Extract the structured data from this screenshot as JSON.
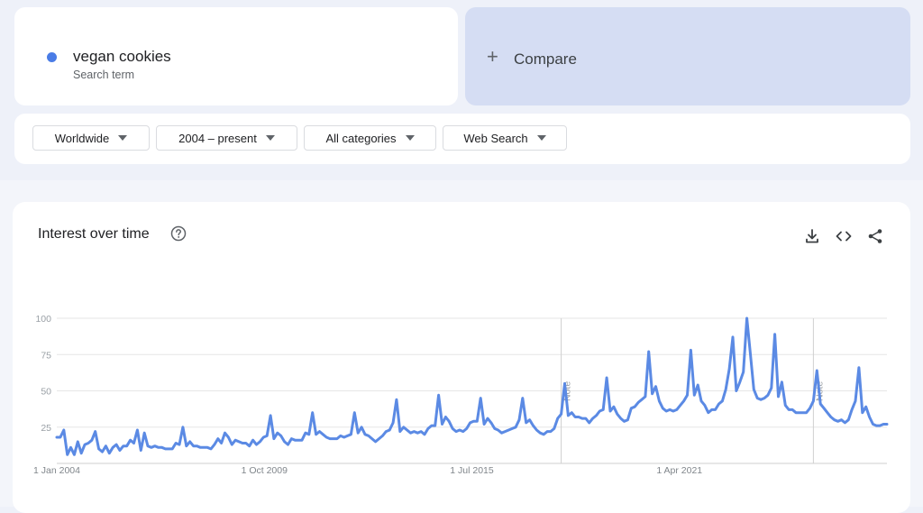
{
  "search_term": {
    "name": "vegan cookies",
    "subtitle": "Search term",
    "color": "#4a7ce6"
  },
  "compare": {
    "label": "Compare"
  },
  "filters": {
    "region": "Worldwide",
    "time": "2004 – present",
    "category": "All categories",
    "property": "Web Search"
  },
  "chart_panel": {
    "title": "Interest over time"
  },
  "icons": [
    "help-icon",
    "download-icon",
    "embed-icon",
    "share-icon"
  ],
  "chart_data": {
    "type": "line",
    "title": "Interest over time",
    "xlabel": "",
    "ylabel": "",
    "ylim": [
      0,
      100
    ],
    "yticks": [
      25,
      50,
      75,
      100
    ],
    "xtick_labels": [
      "1 Jan 2004",
      "1 Oct 2009",
      "1 Jul 2015",
      "1 Apr 2021"
    ],
    "notes": [
      {
        "label": "Note",
        "date": "2016-01"
      },
      {
        "label": "Note",
        "date": "2022-01"
      }
    ],
    "grid": true,
    "legend": "none",
    "series": [
      {
        "name": "vegan cookies",
        "color": "#5b8ae4",
        "x_start": "2004-01",
        "x_step": "month",
        "values": [
          18,
          18,
          23,
          6,
          11,
          6,
          15,
          7,
          13,
          14,
          16,
          22,
          10,
          8,
          12,
          7,
          11,
          13,
          9,
          12,
          12,
          16,
          14,
          23,
          9,
          21,
          12,
          11,
          12,
          11,
          11,
          10,
          10,
          10,
          14,
          13,
          25,
          12,
          15,
          12,
          12,
          11,
          11,
          11,
          10,
          13,
          17,
          14,
          21,
          18,
          13,
          16,
          15,
          14,
          14,
          12,
          16,
          13,
          15,
          18,
          19,
          33,
          17,
          21,
          19,
          15,
          13,
          17,
          16,
          16,
          16,
          21,
          20,
          35,
          20,
          22,
          20,
          18,
          17,
          17,
          17,
          19,
          18,
          19,
          20,
          35,
          21,
          25,
          20,
          19,
          17,
          15,
          17,
          19,
          22,
          23,
          28,
          44,
          22,
          25,
          23,
          21,
          22,
          21,
          22,
          20,
          24,
          26,
          26,
          47,
          27,
          32,
          29,
          24,
          22,
          23,
          22,
          24,
          28,
          29,
          29,
          45,
          27,
          31,
          28,
          24,
          23,
          21,
          22,
          23,
          24,
          25,
          30,
          45,
          28,
          30,
          26,
          23,
          21,
          20,
          22,
          22,
          24,
          31,
          34,
          55,
          33,
          35,
          32,
          32,
          31,
          31,
          28,
          31,
          33,
          36,
          37,
          59,
          36,
          39,
          34,
          31,
          29,
          30,
          38,
          39,
          42,
          44,
          46,
          77,
          48,
          53,
          43,
          38,
          36,
          37,
          36,
          37,
          40,
          43,
          47,
          78,
          47,
          54,
          43,
          40,
          35,
          37,
          37,
          41,
          43,
          51,
          65,
          87,
          50,
          56,
          63,
          100,
          76,
          51,
          45,
          44,
          45,
          47,
          52,
          89,
          46,
          56,
          40,
          37,
          37,
          35,
          35,
          35,
          35,
          38,
          43,
          64,
          41,
          38,
          35,
          32,
          30,
          29,
          30,
          28,
          30,
          37,
          43,
          66,
          35,
          39,
          32,
          27,
          26,
          26,
          27,
          27
        ]
      }
    ]
  }
}
